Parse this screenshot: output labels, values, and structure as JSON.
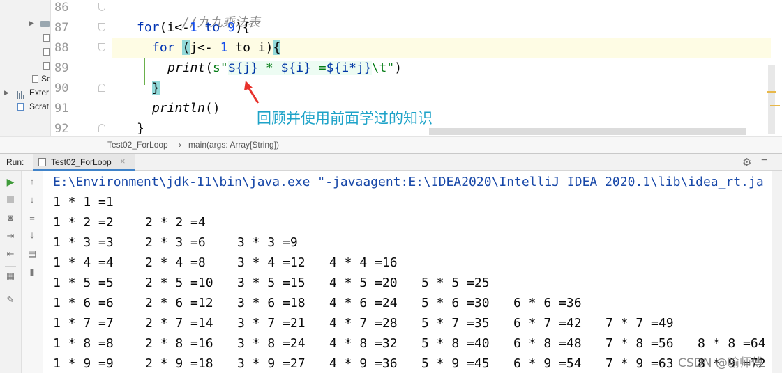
{
  "project_tree": {
    "items": [
      {
        "label": "",
        "kind": "folder"
      },
      {
        "label": "",
        "kind": "file"
      },
      {
        "label": "",
        "kind": "file"
      },
      {
        "label": "",
        "kind": "file"
      },
      {
        "label": "Sc",
        "kind": "file"
      },
      {
        "label": "Exter",
        "kind": "library"
      },
      {
        "label": "Scrat",
        "kind": "scratch"
      }
    ]
  },
  "editor": {
    "line_numbers": [
      "86",
      "87",
      "88",
      "89",
      "90",
      "91",
      "92"
    ],
    "code": {
      "comment": "//九九乘法表",
      "l87_for": "for",
      "l87_a": "(i<-",
      "l87_n1": "1",
      "l87_to": " to ",
      "l87_n2": "9",
      "l87_b": "){",
      "l88_for": "for ",
      "l88_paren": "(",
      "l88_a": "j<- ",
      "l88_n1": "1",
      "l88_b": " to i)",
      "l88_brace": "{",
      "l89_print": "print",
      "l89_a": "(",
      "l89_s": "s\"",
      "l89_j": "${j}",
      "l89_m": " * ",
      "l89_i": "${i}",
      "l89_eq": " =",
      "l89_ij": "${i*j}",
      "l89_t": "\\t\"",
      "l89_close": ")",
      "l90_brace": "}",
      "l91_println": "println",
      "l91_paren": "()",
      "l92_brace": "}"
    },
    "annotation": "回顾并使用前面学过的知识",
    "breadcrumb": [
      "Test02_ForLoop",
      "›",
      "main(args: Array[String])"
    ]
  },
  "run": {
    "label": "Run:",
    "tab_label": "Test02_ForLoop",
    "tab_close": "×",
    "gear": "⚙",
    "minimize": "−",
    "command": "E:\\Environment\\jdk-11\\bin\\java.exe \"-javaagent:E:\\IDEA2020\\IntelliJ IDEA 2020.1\\lib\\idea_rt.ja",
    "output": [
      [
        "1 * 1 =1"
      ],
      [
        "1 * 2 =2",
        "2 * 2 =4"
      ],
      [
        "1 * 3 =3",
        "2 * 3 =6",
        "3 * 3 =9"
      ],
      [
        "1 * 4 =4",
        "2 * 4 =8",
        "3 * 4 =12",
        "4 * 4 =16"
      ],
      [
        "1 * 5 =5",
        "2 * 5 =10",
        "3 * 5 =15",
        "4 * 5 =20",
        "5 * 5 =25"
      ],
      [
        "1 * 6 =6",
        "2 * 6 =12",
        "3 * 6 =18",
        "4 * 6 =24",
        "5 * 6 =30",
        "6 * 6 =36"
      ],
      [
        "1 * 7 =7",
        "2 * 7 =14",
        "3 * 7 =21",
        "4 * 7 =28",
        "5 * 7 =35",
        "6 * 7 =42",
        "7 * 7 =49"
      ],
      [
        "1 * 8 =8",
        "2 * 8 =16",
        "3 * 8 =24",
        "4 * 8 =32",
        "5 * 8 =40",
        "6 * 8 =48",
        "7 * 8 =56",
        "8 * 8 =64"
      ],
      [
        "1 * 9 =9",
        "2 * 9 =18",
        "3 * 9 =27",
        "4 * 9 =36",
        "5 * 9 =45",
        "6 * 9 =54",
        "7 * 9 =63",
        "8 * 9 =72"
      ]
    ],
    "toolbar_icons": [
      "play-icon",
      "stop-icon",
      "camera-icon",
      "import-icon",
      "export-icon",
      "layout-icon",
      "pin-icon",
      "up-arrow-icon",
      "down-arrow-icon",
      "soft-wrap-icon",
      "scroll-to-end-icon",
      "print-icon",
      "trash-icon"
    ]
  },
  "watermark": "CSDN @喻师傅",
  "colors": {
    "keyword": "#0033b3",
    "number": "#1750eb",
    "string": "#067d17",
    "annotation": "#1ea3c8",
    "console_command": "#1848a8",
    "brace_highlight": "#93d9d9",
    "current_line": "#fefce4"
  }
}
